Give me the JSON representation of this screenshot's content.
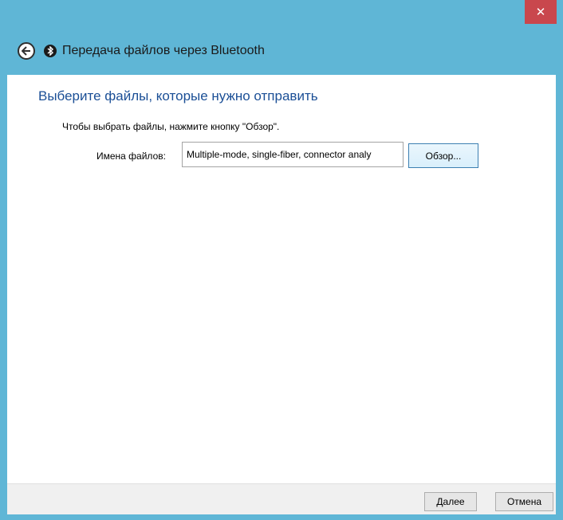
{
  "window": {
    "title": "Передача файлов через Bluetooth",
    "close_glyph": "✕"
  },
  "page": {
    "heading": "Выберите файлы, которые нужно отправить",
    "instruction": "Чтобы выбрать файлы, нажмите кнопку \"Обзор\".",
    "file_label": "Имена файлов:",
    "file_value": "Multiple-mode, single-fiber, connector analy",
    "browse_label": "Обзор..."
  },
  "footer": {
    "next_label": "Далее",
    "cancel_label": "Отмена"
  },
  "icons": {
    "back": "back-arrow-icon",
    "bluetooth": "bluetooth-icon",
    "close": "close-icon"
  },
  "colors": {
    "frame": "#5fb6d6",
    "close": "#c9474d",
    "heading": "#1b4f96",
    "footer": "#f0f0f0"
  }
}
